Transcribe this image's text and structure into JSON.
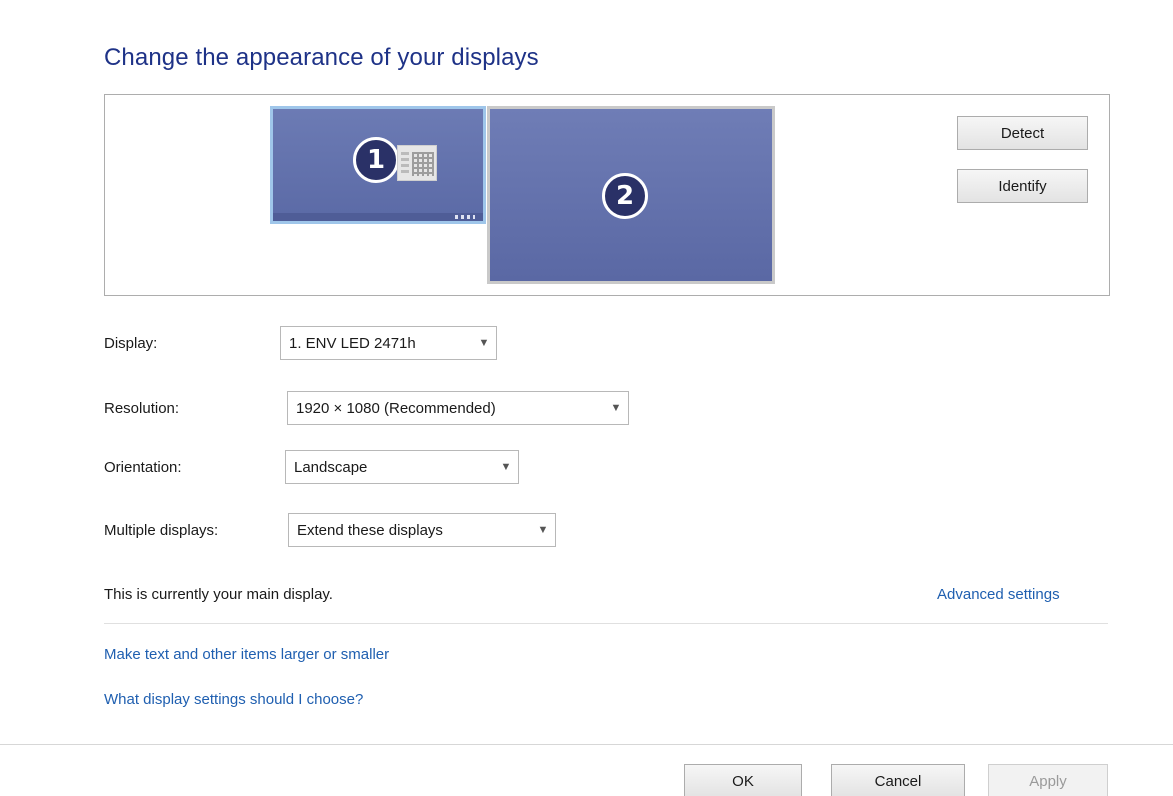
{
  "header": {
    "title": "Change the appearance of your displays"
  },
  "preview": {
    "monitors": [
      {
        "number": "1",
        "selected": true
      },
      {
        "number": "2",
        "selected": false
      }
    ],
    "detect_label": "Detect",
    "identify_label": "Identify"
  },
  "settings": {
    "display_label": "Display:",
    "display_value": "1. ENV LED 2471h",
    "resolution_label": "Resolution:",
    "resolution_value": "1920 × 1080 (Recommended)",
    "orientation_label": "Orientation:",
    "orientation_value": "Landscape",
    "multiple_label": "Multiple displays:",
    "multiple_value": "Extend these displays"
  },
  "status_text": "This is currently your main display.",
  "links": {
    "advanced": "Advanced settings",
    "text_size": "Make text and other items larger or smaller",
    "which_settings": "What display settings should I choose?"
  },
  "footer": {
    "ok": "OK",
    "cancel": "Cancel",
    "apply": "Apply"
  },
  "colors": {
    "title": "#1e3287",
    "link": "#1f5fb0",
    "monitor": "#5f6fa8",
    "selected_border": "#9fc6ea"
  },
  "icons": {
    "dropdown": "chevron-down-icon",
    "start": "start-screen-icon"
  }
}
